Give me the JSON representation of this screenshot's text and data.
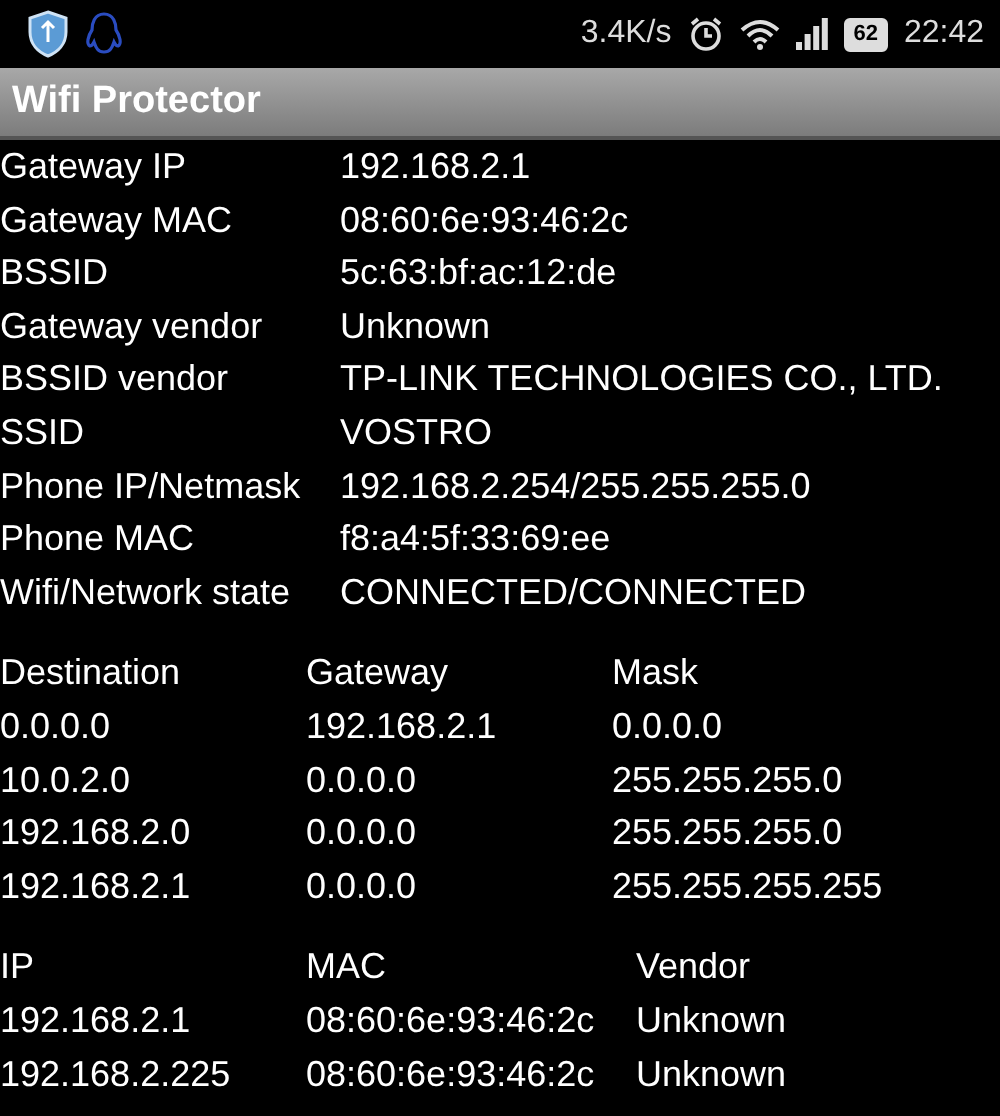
{
  "status_bar": {
    "speed": "3.4K/s",
    "battery": "62",
    "time": "22:42"
  },
  "window": {
    "title": "Wifi Protector"
  },
  "info": [
    {
      "label": "Gateway IP",
      "value": "192.168.2.1"
    },
    {
      "label": "Gateway MAC",
      "value": "08:60:6e:93:46:2c"
    },
    {
      "label": "BSSID",
      "value": "5c:63:bf:ac:12:de"
    },
    {
      "label": "Gateway vendor",
      "value": "Unknown"
    },
    {
      "label": "BSSID vendor",
      "value": "TP-LINK TECHNOLOGIES CO., LTD."
    },
    {
      "label": "SSID",
      "value": "VOSTRO"
    },
    {
      "label": "Phone IP/Netmask",
      "value": "192.168.2.254/255.255.255.0"
    },
    {
      "label": "Phone MAC",
      "value": "f8:a4:5f:33:69:ee"
    },
    {
      "label": "Wifi/Network state",
      "value": "CONNECTED/CONNECTED"
    }
  ],
  "routes": {
    "columns": [
      "Destination",
      "Gateway",
      "Mask"
    ],
    "rows": [
      [
        "0.0.0.0",
        "192.168.2.1",
        "0.0.0.0"
      ],
      [
        "10.0.2.0",
        "0.0.0.0",
        "255.255.255.0"
      ],
      [
        "192.168.2.0",
        "0.0.0.0",
        "255.255.255.0"
      ],
      [
        "192.168.2.1",
        "0.0.0.0",
        "255.255.255.255"
      ]
    ]
  },
  "neighbors": {
    "columns": [
      "IP",
      "MAC",
      "Vendor"
    ],
    "rows": [
      [
        "192.168.2.1",
        "08:60:6e:93:46:2c",
        "Unknown"
      ],
      [
        "192.168.2.225",
        "08:60:6e:93:46:2c",
        "Unknown"
      ]
    ]
  }
}
